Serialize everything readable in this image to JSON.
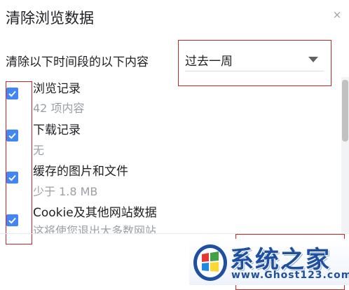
{
  "dialog": {
    "title": "清除浏览数据",
    "close_glyph": "×"
  },
  "time_range": {
    "label": "清除以下时间段的以下内容",
    "selected": "过去一周"
  },
  "items": [
    {
      "label": "浏览记录",
      "detail": "42 项内容",
      "checked": true
    },
    {
      "label": "下载记录",
      "detail": "无",
      "checked": true
    },
    {
      "label": "缓存的图片和文件",
      "detail": "少于 1.8 MB",
      "checked": true
    },
    {
      "label": "Cookie及其他网站数据",
      "detail": "这将使您退出大多数网站",
      "checked": true
    }
  ],
  "watermark": {
    "title": "系统之家",
    "url": "www.Ghost123.com"
  },
  "colors": {
    "accent": "#4285f4",
    "highlight": "#c62828",
    "watermark": "#1f4fa0"
  },
  "icons": {
    "close": "close-icon",
    "dropdown": "dropdown-arrow-icon",
    "checkbox": "checkmark-icon",
    "logo": "windows-logo-icon"
  }
}
